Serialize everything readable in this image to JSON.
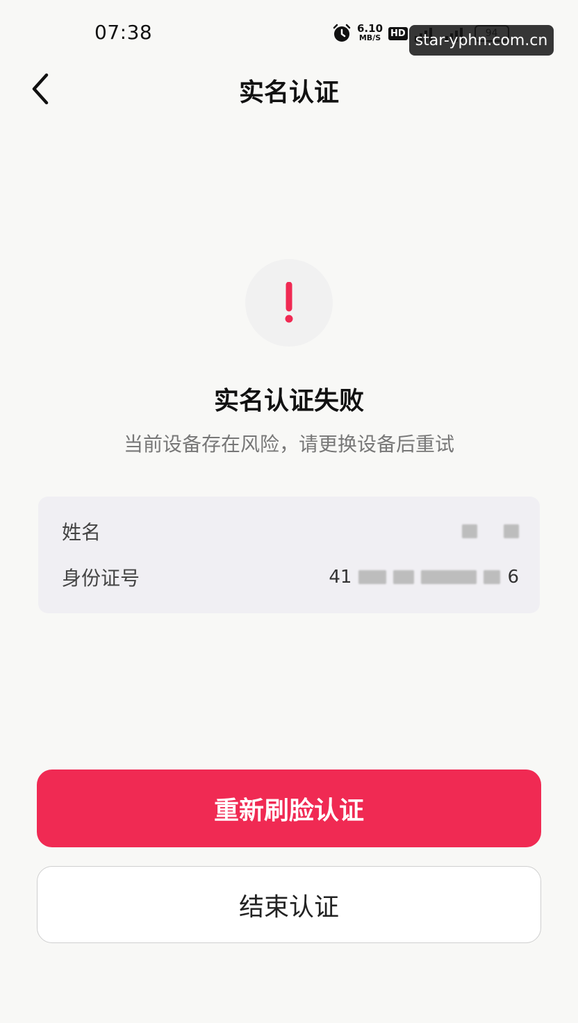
{
  "status_bar": {
    "time": "07:38",
    "net_speed_value": "6.10",
    "net_speed_unit": "MB/S",
    "hd_label": "HD",
    "battery": "94",
    "icons": [
      "alarm-icon",
      "signal-5g-icon",
      "signal-4g-icon",
      "battery-icon"
    ],
    "watermark": "star-yphn.com.cn"
  },
  "header": {
    "title": "实名认证",
    "back_icon": "chevron-left-icon"
  },
  "result": {
    "icon": "exclamation-icon",
    "icon_color": "#f02a53",
    "title": "实名认证失败",
    "description": "当前设备存在风险，请更换设备后重试"
  },
  "info": {
    "name_label": "姓名",
    "id_label": "身份证号",
    "id_prefix": "41",
    "id_suffix": "6"
  },
  "actions": {
    "retry_label": "重新刷脸认证",
    "end_label": "结束认证",
    "accent_color": "#f02a53"
  }
}
